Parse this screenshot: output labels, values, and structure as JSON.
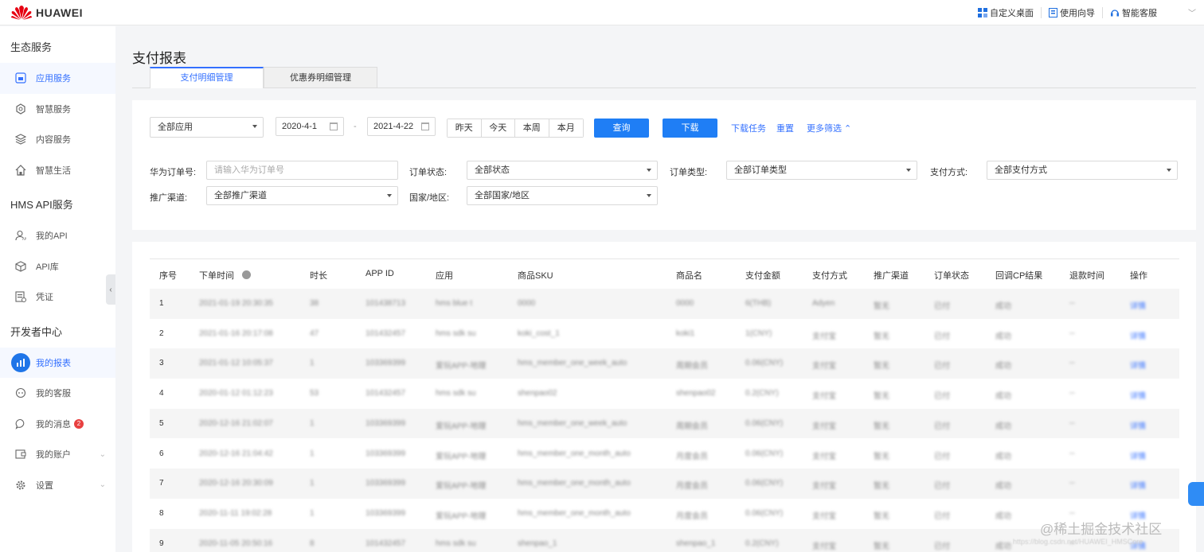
{
  "header": {
    "brand": "HUAWEI",
    "links": [
      {
        "label": "自定义桌面",
        "icon": "grid-icon"
      },
      {
        "label": "使用向导",
        "icon": "guide-icon"
      },
      {
        "label": "智能客服",
        "icon": "headset-icon"
      }
    ]
  },
  "sidebar": {
    "sections": [
      {
        "title": "生态服务",
        "items": [
          {
            "label": "应用服务",
            "icon": "app-service-icon",
            "active": true
          },
          {
            "label": "智慧服务",
            "icon": "smart-service-icon"
          },
          {
            "label": "内容服务",
            "icon": "content-service-icon"
          },
          {
            "label": "智慧生活",
            "icon": "smart-life-icon"
          }
        ]
      },
      {
        "title": "HMS API服务",
        "items": [
          {
            "label": "我的API",
            "icon": "user-api-icon"
          },
          {
            "label": "API库",
            "icon": "cube-icon"
          },
          {
            "label": "凭证",
            "icon": "credential-icon"
          }
        ]
      },
      {
        "title": "开发者中心",
        "items": [
          {
            "label": "我的报表",
            "icon": "bar-chart-icon",
            "selected": true
          },
          {
            "label": "我的客服",
            "icon": "support-icon"
          },
          {
            "label": "我的消息",
            "icon": "message-icon",
            "badge": "2"
          },
          {
            "label": "我的账户",
            "icon": "account-icon",
            "expandable": true
          },
          {
            "label": "设置",
            "icon": "gear-icon",
            "expandable": true
          }
        ]
      }
    ]
  },
  "page": {
    "title": "支付报表",
    "tabs": [
      "支付明细管理",
      "优惠券明细管理"
    ]
  },
  "filters": {
    "app_select": "全部应用",
    "date_from": "2020-4-1",
    "date_sep": "-",
    "date_to": "2021-4-22",
    "quick_ranges": [
      "昨天",
      "今天",
      "本周",
      "本月"
    ],
    "query_button": "查询",
    "download_button": "下载",
    "download_tasks": "下载任务",
    "reset": "重置",
    "more_filters": "更多筛选",
    "order_no_label": "华为订单号:",
    "order_no_placeholder": "请输入华为订单号",
    "order_status_label": "订单状态:",
    "order_status_value": "全部状态",
    "order_type_label": "订单类型:",
    "order_type_value": "全部订单类型",
    "pay_method_label": "支付方式:",
    "pay_method_value": "全部支付方式",
    "channel_label": "推广渠道:",
    "channel_value": "全部推广渠道",
    "region_label": "国家/地区:",
    "region_value": "全部国家/地区"
  },
  "table": {
    "columns": [
      "序号",
      "下单时间",
      "时长",
      "APP ID",
      "应用",
      "商品SKU",
      "商品名",
      "支付金额",
      "支付方式",
      "推广渠道",
      "订单状态",
      "回调CP结果",
      "退款时间",
      "操作"
    ],
    "rows": [
      [
        "1",
        "2021-01-19 20:30:35",
        "38",
        "101438713",
        "hms blue t",
        "0000",
        "0000",
        "6(THB)",
        "Adyen",
        "暂无",
        "已付",
        "成功",
        "--",
        "详情"
      ],
      [
        "2",
        "2021-01-16 20:17:08",
        "47",
        "101432457",
        "hms sdk su",
        "koki_cost_1",
        "koki1",
        "1(CNY)",
        "支付宝",
        "暂无",
        "已付",
        "成功",
        "--",
        "详情"
      ],
      [
        "3",
        "2021-01-12 10:05:37",
        "1",
        "103369399",
        "爱玩APP-地理",
        "hms_member_one_week_auto",
        "周期会员",
        "0.06(CNY)",
        "支付宝",
        "暂无",
        "已付",
        "成功",
        "--",
        "详情"
      ],
      [
        "4",
        "2020-01-12 01:12:23",
        "53",
        "101432457",
        "hms sdk su",
        "shenpao02",
        "shenpao02",
        "0.2(CNY)",
        "支付宝",
        "暂无",
        "已付",
        "成功",
        "--",
        "详情"
      ],
      [
        "5",
        "2020-12-16 21:02:07",
        "1",
        "103369399",
        "爱玩APP-地理",
        "hms_member_one_week_auto",
        "周期会员",
        "0.06(CNY)",
        "支付宝",
        "暂无",
        "已付",
        "成功",
        "--",
        "详情"
      ],
      [
        "6",
        "2020-12-16 21:04:42",
        "1",
        "103369399",
        "爱玩APP-地理",
        "hms_member_one_month_auto",
        "月度会员",
        "0.06(CNY)",
        "支付宝",
        "暂无",
        "已付",
        "成功",
        "--",
        "详情"
      ],
      [
        "7",
        "2020-12-16 20:30:09",
        "1",
        "103369399",
        "爱玩APP-地理",
        "hms_member_one_month_auto",
        "月度会员",
        "0.06(CNY)",
        "支付宝",
        "暂无",
        "已付",
        "成功",
        "--",
        "详情"
      ],
      [
        "8",
        "2020-11-11 19:02:28",
        "1",
        "103369399",
        "爱玩APP-地理",
        "hms_member_one_month_auto",
        "月度会员",
        "0.06(CNY)",
        "支付宝",
        "暂无",
        "已付",
        "成功",
        "--",
        "详情"
      ],
      [
        "9",
        "2020-11-05 20:50:16",
        "8",
        "101432457",
        "hms sdk su",
        "shenpao_1",
        "shenpao_1",
        "0.2(CNY)",
        "支付宝",
        "暂无",
        "已付",
        "成功",
        "--",
        "详情"
      ]
    ]
  },
  "watermark": {
    "text": "@稀土掘金技术社区",
    "url": "https://blog.csdn.net/HUAWEI_HMSCore"
  },
  "colors": {
    "accent": "#3370ff",
    "primary_button": "#1f7ef5",
    "logo_red": "#e60012",
    "badge": "#e84040"
  }
}
